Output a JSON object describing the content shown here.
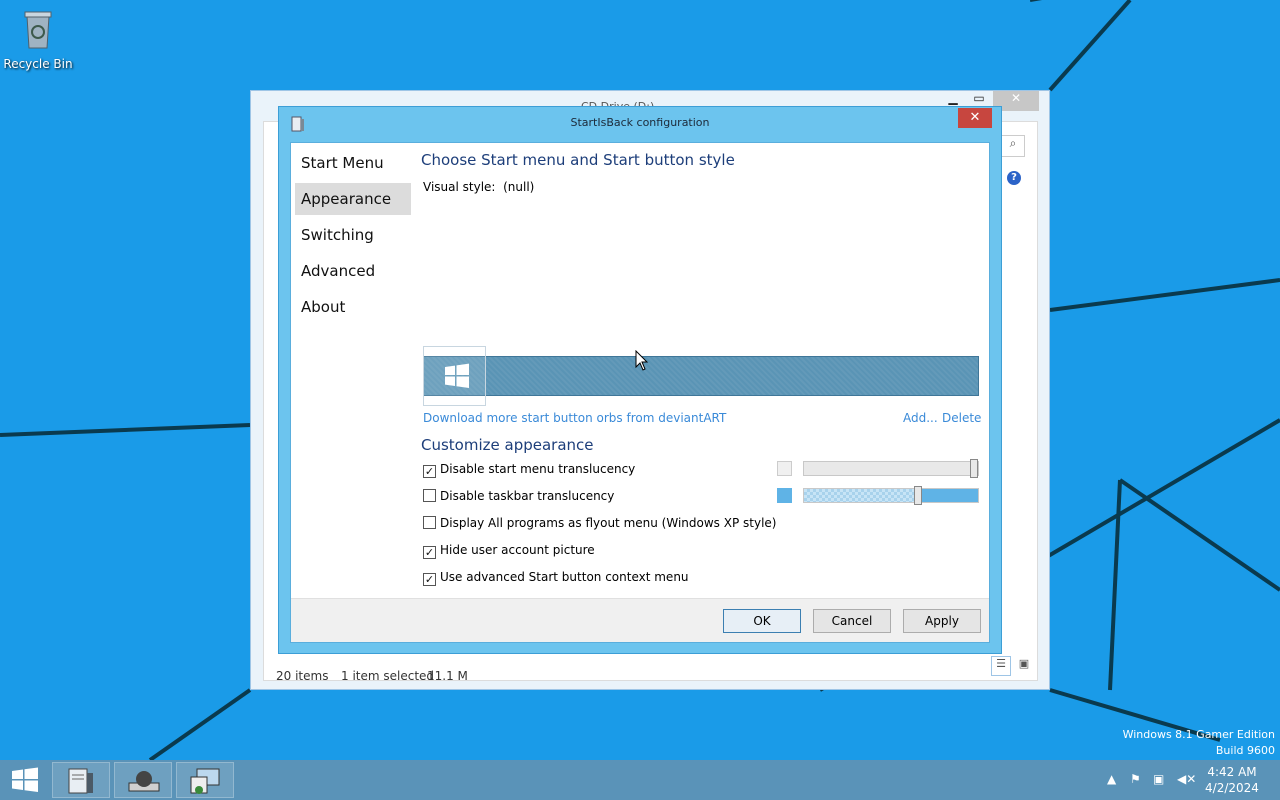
{
  "desktop": {
    "icons": [
      {
        "label": "Recycle Bin",
        "icon": "recycle-bin-icon"
      }
    ],
    "watermark": {
      "line1": "Windows 8.1 Gamer Edition",
      "line2": "Build 9600"
    },
    "background_color": "#1a9be8"
  },
  "explorer": {
    "title": "CD Drive (D:) ...",
    "status": {
      "items": "20 items",
      "selected": "1 item selected",
      "size": "11.1 MB"
    }
  },
  "dialog": {
    "title": "StartIsBack configuration",
    "nav": [
      "Start Menu",
      "Appearance",
      "Switching",
      "Advanced",
      "About"
    ],
    "active_nav": "Appearance",
    "heading": "Choose Start menu and Start button style",
    "visual_style_label": "Visual style:",
    "visual_style_value": "(null)",
    "download_link": "Download more start button orbs from deviantART",
    "add_link": "Add...",
    "delete_link": "Delete",
    "customize_heading": "Customize appearance",
    "options": [
      {
        "label": "Disable start menu translucency",
        "checked": true
      },
      {
        "label": "Disable taskbar translucency",
        "checked": false
      },
      {
        "label": "Display All programs as flyout menu (Windows XP style)",
        "checked": false
      },
      {
        "label": "Hide user account picture",
        "checked": true
      },
      {
        "label": "Use advanced Start button context menu",
        "checked": true
      }
    ],
    "start_menu_slider": {
      "level": 0.97,
      "color": "#f0f0f0"
    },
    "taskbar_slider": {
      "level": 0.65,
      "color": "#5fb3e6"
    },
    "buttons": {
      "ok": "OK",
      "cancel": "Cancel",
      "apply": "Apply"
    },
    "accent_color": "#6cc4ee"
  },
  "taskbar": {
    "color": "#5a93b8",
    "clock": {
      "time": "4:42 AM",
      "date": "4/2/2024"
    },
    "tray_icons": [
      "show-hidden-icons",
      "flag-icon",
      "network-icon",
      "speaker-muted-icon"
    ]
  }
}
